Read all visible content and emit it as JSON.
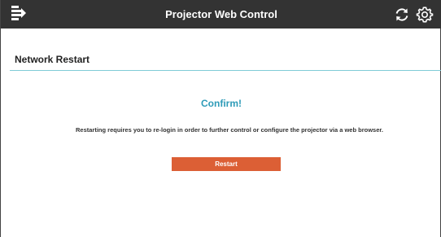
{
  "header": {
    "title": "Projector Web Control",
    "icons": {
      "menu": "menu-icon",
      "refresh": "refresh-icon",
      "settings": "gear-icon"
    },
    "background": "#333333"
  },
  "page": {
    "section_title": "Network Restart",
    "confirm_title": "Confirm!",
    "message": "Restarting requires you to re-login in order to further control or configure the projector via a web browser.",
    "restart_label": "Restart"
  },
  "colors": {
    "accent": "#2e9bb8",
    "divider": "#7fcbd7",
    "button": "#dc5f35"
  }
}
